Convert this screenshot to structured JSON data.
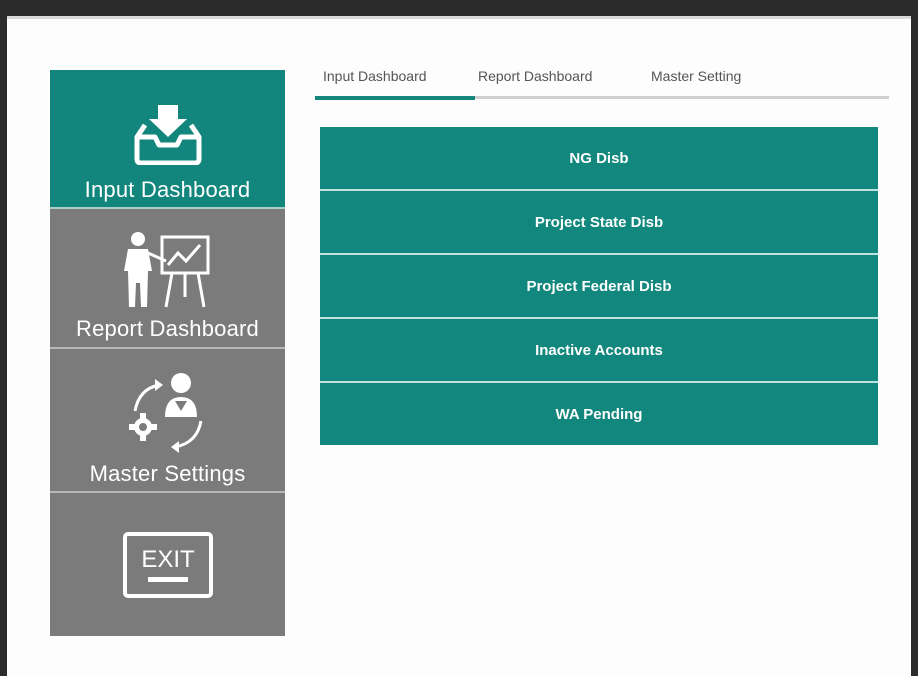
{
  "sidebar": {
    "items": [
      {
        "label": "Input Dashboard",
        "icon": "inbox-download-icon"
      },
      {
        "label": "Report Dashboard",
        "icon": "presentation-icon"
      },
      {
        "label": "Master Settings",
        "icon": "user-settings-icon"
      },
      {
        "label": "EXIT",
        "icon": "exit-icon"
      }
    ]
  },
  "tabs": {
    "items": [
      {
        "label": "Input Dashboard"
      },
      {
        "label": "Report Dashboard"
      },
      {
        "label": "Master Setting"
      }
    ],
    "active": "Input Dashboard"
  },
  "panel": {
    "buttons": [
      {
        "label": "NG Disb"
      },
      {
        "label": "Project State Disb"
      },
      {
        "label": "Project Federal Disb"
      },
      {
        "label": "Inactive Accounts"
      },
      {
        "label": "WA Pending"
      }
    ]
  },
  "colors": {
    "accent": "#12867c",
    "sidebar_gray": "#7b7b7b",
    "window_bg": "#fdfdfd",
    "frame": "#2b2b2b"
  }
}
